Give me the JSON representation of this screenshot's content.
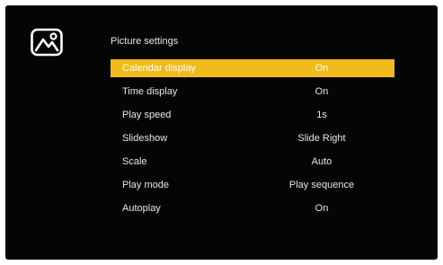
{
  "header": {
    "icon": "picture-icon",
    "title": "Picture settings"
  },
  "colors": {
    "background": "#050505",
    "highlight": "#f0bb1c",
    "text": "#e6e6e6"
  },
  "settings": [
    {
      "label": "Calendar display",
      "value": "On",
      "selected": true
    },
    {
      "label": "Time display",
      "value": "On",
      "selected": false
    },
    {
      "label": "Play speed",
      "value": "1s",
      "selected": false
    },
    {
      "label": "Slideshow",
      "value": "Slide Right",
      "selected": false
    },
    {
      "label": "Scale",
      "value": "Auto",
      "selected": false
    },
    {
      "label": "Play mode",
      "value": "Play sequence",
      "selected": false
    },
    {
      "label": "Autoplay",
      "value": "On",
      "selected": false
    }
  ]
}
